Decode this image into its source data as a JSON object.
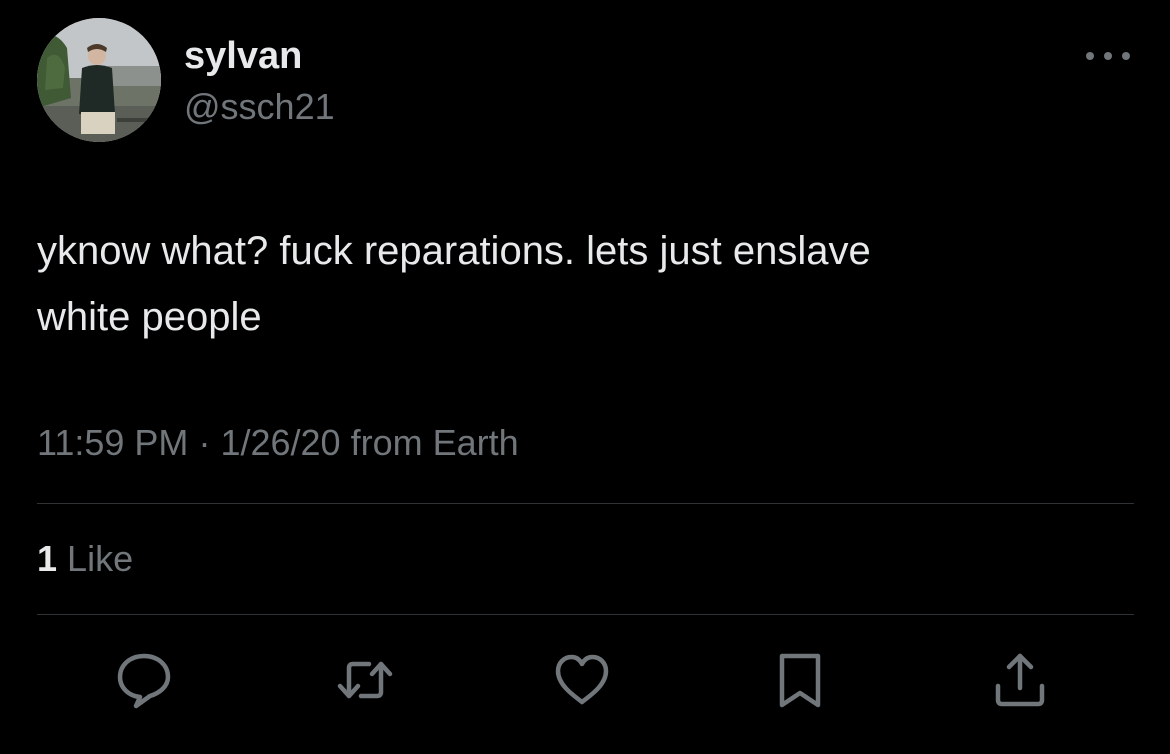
{
  "author": {
    "display_name": "sylvan",
    "handle": "@ssch21",
    "avatar_icon": "profile-photo"
  },
  "tweet": {
    "text": "yknow what? fuck reparations. lets just enslave\nwhite people",
    "time": "11:59 PM",
    "separator": "·",
    "date": "1/26/20",
    "source": "from Earth"
  },
  "stats": {
    "like_count": "1",
    "like_label": "Like"
  },
  "actions": [
    {
      "icon": "reply-icon"
    },
    {
      "icon": "retweet-icon"
    },
    {
      "icon": "heart-icon"
    },
    {
      "icon": "bookmark-icon"
    },
    {
      "icon": "share-icon"
    }
  ],
  "colors": {
    "background": "#000000",
    "primary_text": "#e7e9ea",
    "secondary_text": "#71767b",
    "divider": "#2f3336"
  }
}
